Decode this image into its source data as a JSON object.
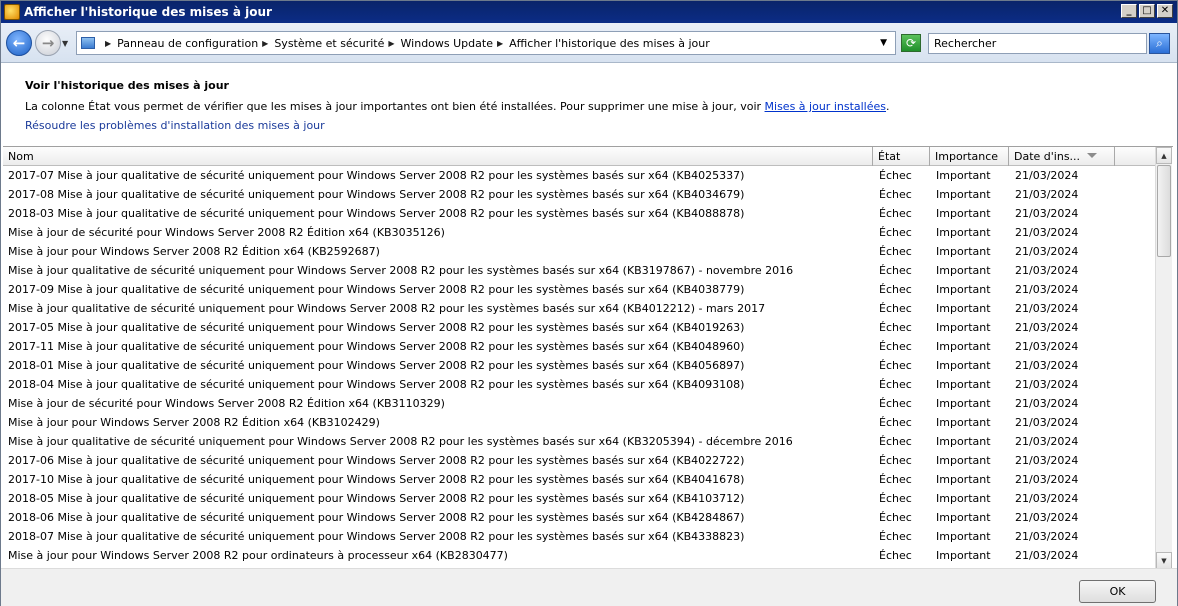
{
  "window": {
    "title": "Afficher l'historique des mises à jour",
    "buttons": {
      "minimize": "_",
      "maximize": "□",
      "close": "✕"
    }
  },
  "address": {
    "back_glyph": "←",
    "forward_glyph": "→",
    "breadcrumb": [
      "Panneau de configuration",
      "Système et sécurité",
      "Windows Update",
      "Afficher l'historique des mises à jour"
    ],
    "search_placeholder": "Rechercher"
  },
  "header": {
    "title": "Voir l'historique des mises à jour",
    "description": "La colonne État vous permet de vérifier que les mises à jour importantes ont bien été installées. Pour supprimer une mise à jour, voir ",
    "installed_link": "Mises à jour installées",
    "description_end": ".",
    "troubleshoot_link": "Résoudre les problèmes d'installation des mises à jour"
  },
  "table": {
    "columns": {
      "name": "Nom",
      "state": "État",
      "importance": "Importance",
      "date": "Date d'ins..."
    },
    "rows": [
      {
        "name": "2017-07 Mise à jour qualitative de sécurité uniquement pour Windows Server 2008 R2 pour les systèmes basés sur x64 (KB4025337)",
        "state": "Échec",
        "importance": "Important",
        "date": "21/03/2024"
      },
      {
        "name": "2017-08 Mise à jour qualitative de sécurité uniquement pour Windows Server 2008 R2 pour les systèmes basés sur x64 (KB4034679)",
        "state": "Échec",
        "importance": "Important",
        "date": "21/03/2024"
      },
      {
        "name": "2018-03 Mise à jour qualitative de sécurité uniquement pour Windows Server 2008 R2 pour les systèmes basés sur x64 (KB4088878)",
        "state": "Échec",
        "importance": "Important",
        "date": "21/03/2024"
      },
      {
        "name": "Mise à jour de sécurité pour Windows Server 2008 R2 Édition x64 (KB3035126)",
        "state": "Échec",
        "importance": "Important",
        "date": "21/03/2024"
      },
      {
        "name": "Mise à jour pour Windows Server 2008 R2 Édition x64 (KB2592687)",
        "state": "Échec",
        "importance": "Important",
        "date": "21/03/2024"
      },
      {
        "name": "Mise à jour qualitative de sécurité uniquement pour Windows Server 2008 R2 pour les systèmes basés sur x64 (KB3197867) - novembre 2016",
        "state": "Échec",
        "importance": "Important",
        "date": "21/03/2024"
      },
      {
        "name": "2017-09 Mise à jour qualitative de sécurité uniquement pour Windows Server 2008 R2 pour les systèmes basés sur x64 (KB4038779)",
        "state": "Échec",
        "importance": "Important",
        "date": "21/03/2024"
      },
      {
        "name": "Mise à jour qualitative de sécurité uniquement pour Windows Server 2008 R2 pour les systèmes basés sur x64 (KB4012212) - mars 2017",
        "state": "Échec",
        "importance": "Important",
        "date": "21/03/2024"
      },
      {
        "name": "2017-05 Mise à jour qualitative de sécurité uniquement pour Windows Server 2008 R2 pour les systèmes basés sur x64 (KB4019263)",
        "state": "Échec",
        "importance": "Important",
        "date": "21/03/2024"
      },
      {
        "name": "2017-11 Mise à jour qualitative de sécurité uniquement pour Windows Server 2008 R2 pour les systèmes basés sur x64 (KB4048960)",
        "state": "Échec",
        "importance": "Important",
        "date": "21/03/2024"
      },
      {
        "name": "2018-01 Mise à jour qualitative de sécurité uniquement pour Windows Server 2008 R2 pour les systèmes basés sur x64 (KB4056897)",
        "state": "Échec",
        "importance": "Important",
        "date": "21/03/2024"
      },
      {
        "name": "2018-04 Mise à jour qualitative de sécurité uniquement pour Windows Server 2008 R2 pour les systèmes basés sur x64 (KB4093108)",
        "state": "Échec",
        "importance": "Important",
        "date": "21/03/2024"
      },
      {
        "name": "Mise à jour de sécurité pour Windows Server 2008 R2 Édition x64 (KB3110329)",
        "state": "Échec",
        "importance": "Important",
        "date": "21/03/2024"
      },
      {
        "name": "Mise à jour pour Windows Server 2008 R2 Édition x64 (KB3102429)",
        "state": "Échec",
        "importance": "Important",
        "date": "21/03/2024"
      },
      {
        "name": "Mise à jour qualitative de sécurité uniquement pour Windows Server 2008 R2 pour les systèmes basés sur x64 (KB3205394) - décembre 2016",
        "state": "Échec",
        "importance": "Important",
        "date": "21/03/2024"
      },
      {
        "name": "2017-06 Mise à jour qualitative de sécurité uniquement pour Windows Server 2008 R2 pour les systèmes basés sur x64 (KB4022722)",
        "state": "Échec",
        "importance": "Important",
        "date": "21/03/2024"
      },
      {
        "name": "2017-10 Mise à jour qualitative de sécurité uniquement pour Windows Server 2008 R2 pour les systèmes basés sur x64 (KB4041678)",
        "state": "Échec",
        "importance": "Important",
        "date": "21/03/2024"
      },
      {
        "name": "2018-05 Mise à jour qualitative de sécurité uniquement pour Windows Server 2008 R2 pour les systèmes basés sur x64 (KB4103712)",
        "state": "Échec",
        "importance": "Important",
        "date": "21/03/2024"
      },
      {
        "name": "2018-06 Mise à jour qualitative de sécurité uniquement pour Windows Server 2008 R2 pour les systèmes basés sur x64 (KB4284867)",
        "state": "Échec",
        "importance": "Important",
        "date": "21/03/2024"
      },
      {
        "name": "2018-07 Mise à jour qualitative de sécurité uniquement pour Windows Server 2008 R2 pour les systèmes basés sur x64 (KB4338823)",
        "state": "Échec",
        "importance": "Important",
        "date": "21/03/2024"
      },
      {
        "name": "Mise à jour pour Windows Server 2008 R2 pour ordinateurs à processeur x64 (KB2830477)",
        "state": "Échec",
        "importance": "Important",
        "date": "21/03/2024"
      }
    ]
  },
  "footer": {
    "ok_label": "OK"
  }
}
